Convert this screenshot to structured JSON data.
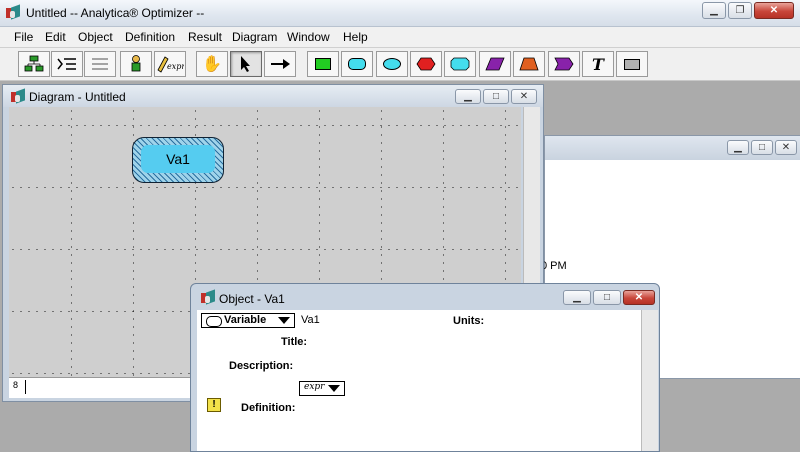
{
  "app": {
    "title": "Untitled -- Analytica® Optimizer --"
  },
  "menu": {
    "items": [
      "File",
      "Edit",
      "Object",
      "Definition",
      "Result",
      "Diagram",
      "Window",
      "Help"
    ]
  },
  "toolbar": {
    "buttons": [
      {
        "name": "diagram-tool",
        "icon": "diagram-hierarchy-icon"
      },
      {
        "name": "outline-tool",
        "icon": "outline-icon"
      },
      {
        "name": "list-tool",
        "icon": "list-icon"
      },
      {
        "name": "object-attributes",
        "icon": "key-person-icon"
      },
      {
        "name": "edit-expr",
        "icon": "pencil-expr-icon",
        "label": "expr"
      },
      {
        "name": "browse-tool",
        "icon": "hand-icon"
      },
      {
        "name": "edit-tool",
        "icon": "arrow-pointer-icon"
      },
      {
        "name": "arrow-tool",
        "icon": "arrow-right-icon"
      },
      {
        "name": "decision-node",
        "icon": "green-rect-icon",
        "color": "#22cc22"
      },
      {
        "name": "variable-node",
        "icon": "cyan-rounded-icon",
        "color": "#44ddee"
      },
      {
        "name": "chance-node",
        "icon": "cyan-ellipse-icon",
        "color": "#44ddee"
      },
      {
        "name": "objective-node",
        "icon": "red-hexagon-icon",
        "color": "#e02020"
      },
      {
        "name": "constant-node",
        "icon": "cyan-octagon-icon",
        "color": "#44ddee"
      },
      {
        "name": "module-node",
        "icon": "purple-parallelogram-icon",
        "color": "#8822aa"
      },
      {
        "name": "index-node",
        "icon": "orange-trapezoid-icon",
        "color": "#e06020"
      },
      {
        "name": "function-node",
        "icon": "purple-chevron-icon",
        "color": "#8822aa"
      },
      {
        "name": "text-node",
        "icon": "text-t-icon",
        "label": "T"
      },
      {
        "name": "picture-node",
        "icon": "gray-rect-icon",
        "color": "#b0b0b0"
      }
    ]
  },
  "diagram_window": {
    "title": "Diagram - Untitled",
    "node": {
      "label": "Va1",
      "color": "#55ccf0"
    }
  },
  "background_window": {
    "partial_text": "0 PM"
  },
  "object_window": {
    "title": "Object - Va1",
    "class_select": "Variable",
    "identifier": "Va1",
    "units_label": "Units:",
    "title_label": "Title:",
    "description_label": "Description:",
    "expr_select": "expr",
    "definition_label": "Definition:"
  },
  "colors": {
    "titlebar": "#dfe6ef",
    "mdi_background": "#ababab",
    "canvas": "#cfcfcf",
    "close_button": "#c8463a"
  }
}
